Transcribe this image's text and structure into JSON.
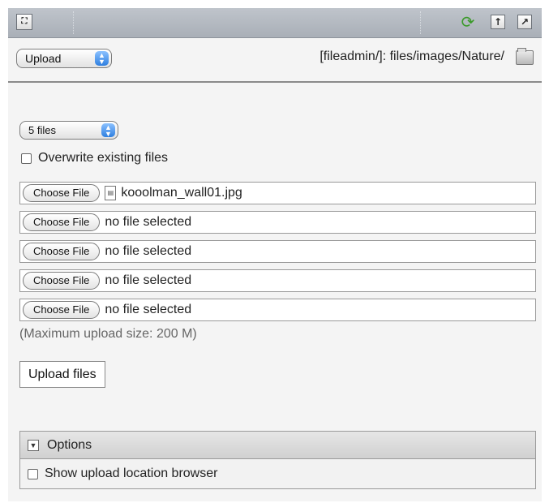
{
  "toolbar": {
    "icons": [
      "fullscreen-icon",
      "refresh-icon",
      "level-up-icon",
      "open-new-window-icon"
    ]
  },
  "action_select": {
    "selected": "Upload"
  },
  "path": {
    "text": "[fileadmin/]: files/images/Nature/"
  },
  "files_select": {
    "selected": "5 files"
  },
  "overwrite": {
    "label": "Overwrite existing files",
    "checked": false
  },
  "file_inputs": [
    {
      "button": "Choose File",
      "value": "kooolman_wall01.jpg",
      "has_icon": true
    },
    {
      "button": "Choose File",
      "value": "no file selected",
      "has_icon": false
    },
    {
      "button": "Choose File",
      "value": "no file selected",
      "has_icon": false
    },
    {
      "button": "Choose File",
      "value": "no file selected",
      "has_icon": false
    },
    {
      "button": "Choose File",
      "value": "no file selected",
      "has_icon": false
    }
  ],
  "max_upload": "(Maximum upload size: 200 M)",
  "upload_button": "Upload files",
  "options": {
    "title": "Options",
    "show_browser_label": "Show upload location browser",
    "show_browser_checked": false
  }
}
